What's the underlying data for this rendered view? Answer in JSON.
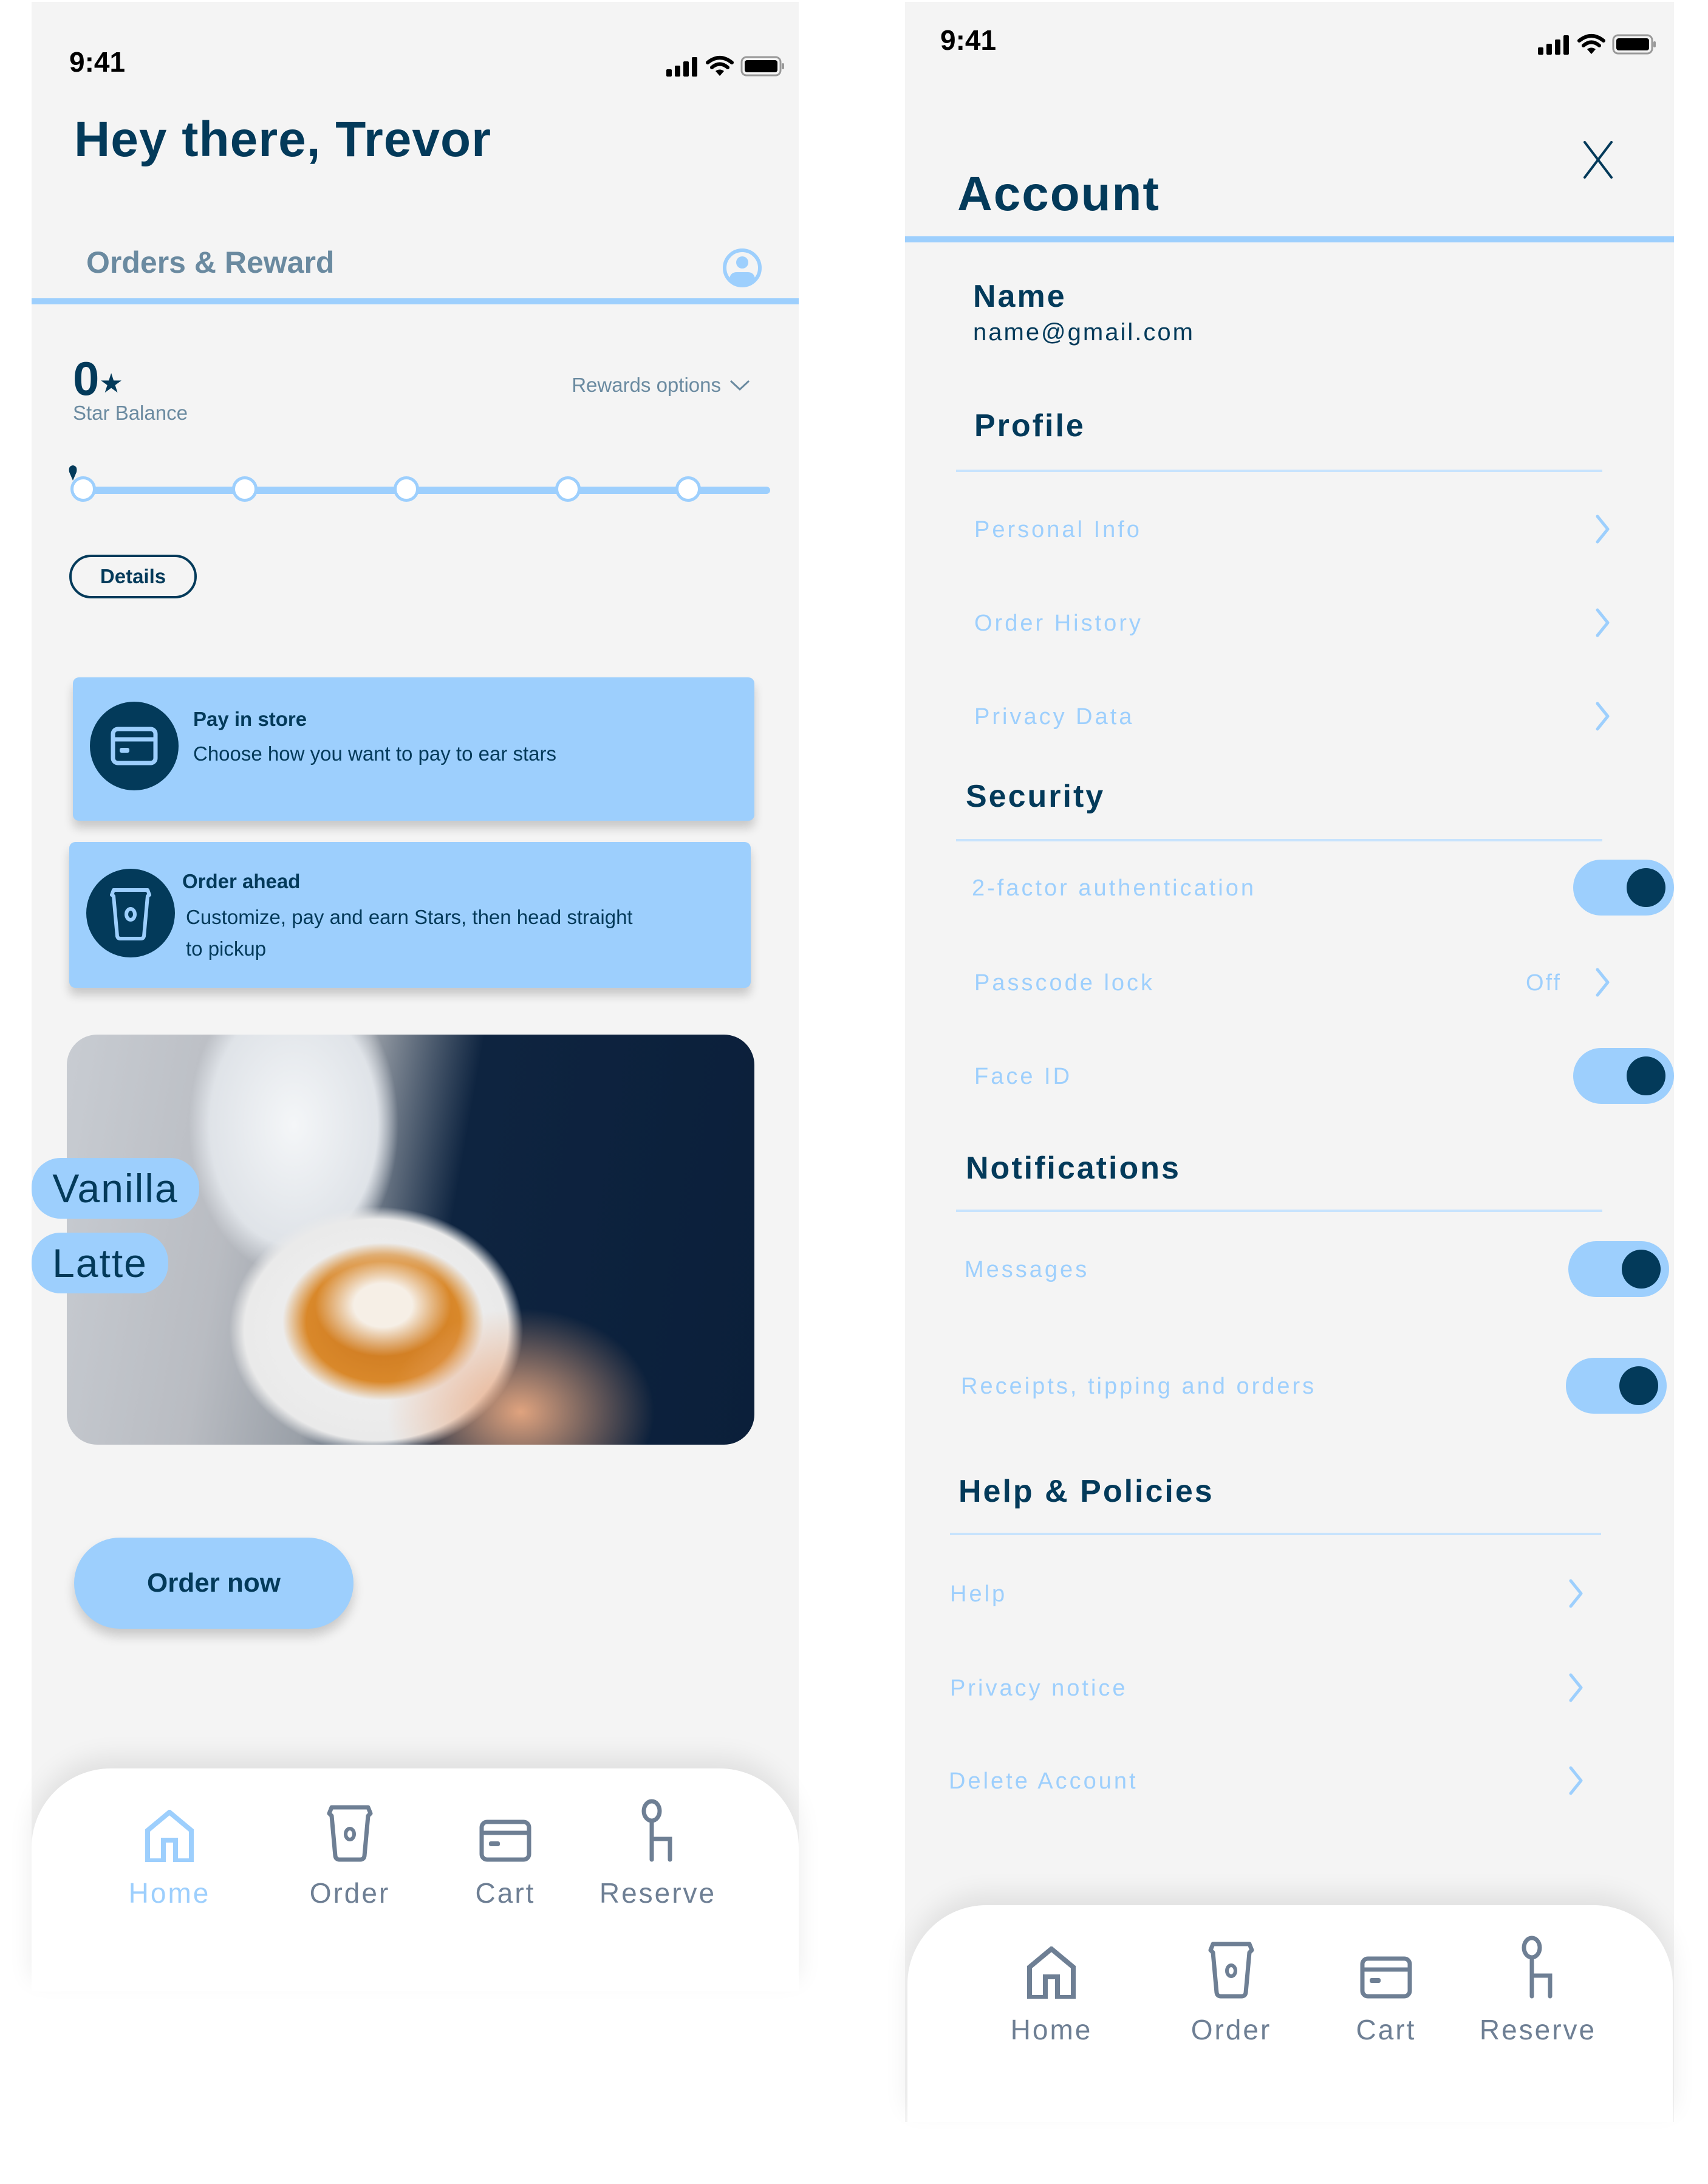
{
  "colors": {
    "navy": "#033a5a",
    "accent_blue": "#9dcffd",
    "muted_slate": "#6a8aa0",
    "inactive_icon": "#6e7f94",
    "screen_bg": "#f4f4f4"
  },
  "home_screen": {
    "status_bar": {
      "time": "9:41",
      "icons": [
        "signal-icon",
        "wifi-icon",
        "battery-icon"
      ]
    },
    "greeting": "Hey there, Trevor",
    "tab": {
      "label": "Orders & Reward",
      "icon": "profile-icon"
    },
    "rewards": {
      "star_balance": "0",
      "star_symbol": "★",
      "star_balance_label": "Star Balance",
      "rewards_options_label": "Rewards options",
      "progress_milestones": 5,
      "progress_fraction": 0
    },
    "details_button": "Details",
    "action_cards": [
      {
        "icon": "credit-card-icon",
        "title": "Pay in store",
        "description": "Choose how you want to pay to ear stars"
      },
      {
        "icon": "coffee-cup-icon",
        "title": "Order ahead",
        "description": "Customize, pay and earn Stars, then head straight to pickup"
      }
    ],
    "featured_drink": {
      "line1": "Vanilla",
      "line2": "Latte",
      "image_alt": "Milk being poured into a latte with latte art"
    },
    "order_now_button": "Order now",
    "bottom_nav": [
      {
        "label": "Home",
        "icon": "home-icon",
        "active": true
      },
      {
        "label": "Order",
        "icon": "coffee-cup-icon",
        "active": false
      },
      {
        "label": "Cart",
        "icon": "credit-card-icon",
        "active": false
      },
      {
        "label": "Reserve",
        "icon": "chair-icon",
        "active": false
      }
    ]
  },
  "account_screen": {
    "status_bar": {
      "time": "9:41",
      "icons": [
        "signal-icon",
        "wifi-icon",
        "battery-icon"
      ]
    },
    "title": "Account",
    "close_icon": "close-icon",
    "user": {
      "name": "Name",
      "email": "name@gmail.com"
    },
    "sections": [
      {
        "heading": "Profile",
        "rows": [
          {
            "label": "Personal Info",
            "control": "chevron"
          },
          {
            "label": "Order History",
            "control": "chevron"
          },
          {
            "label": "Privacy Data",
            "control": "chevron"
          }
        ]
      },
      {
        "heading": "Security",
        "rows": [
          {
            "label": "2-factor authentication",
            "control": "toggle",
            "on": true
          },
          {
            "label": "Passcode lock",
            "control": "chevron",
            "value": "Off"
          },
          {
            "label": "Face ID",
            "control": "toggle",
            "on": true
          }
        ]
      },
      {
        "heading": "Notifications",
        "rows": [
          {
            "label": "Messages",
            "control": "toggle",
            "on": true
          },
          {
            "label": "Receipts, tipping and orders",
            "control": "toggle",
            "on": true
          }
        ]
      },
      {
        "heading": "Help & Policies",
        "rows": [
          {
            "label": "Help",
            "control": "chevron"
          },
          {
            "label": "Privacy notice",
            "control": "chevron"
          },
          {
            "label": "Delete Account",
            "control": "chevron"
          }
        ]
      }
    ],
    "bottom_nav": [
      {
        "label": "Home",
        "icon": "home-icon",
        "active": false
      },
      {
        "label": "Order",
        "icon": "coffee-cup-icon",
        "active": false
      },
      {
        "label": "Cart",
        "icon": "credit-card-icon",
        "active": false
      },
      {
        "label": "Reserve",
        "icon": "chair-icon",
        "active": false
      }
    ]
  }
}
